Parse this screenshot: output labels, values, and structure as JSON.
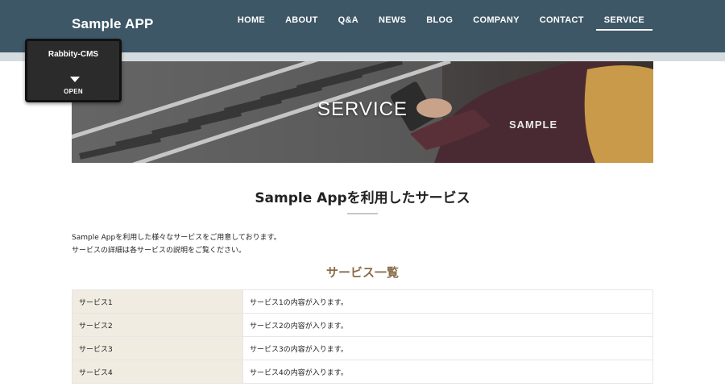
{
  "header": {
    "brand": "Sample APP",
    "nav": [
      "HOME",
      "ABOUT",
      "Q&A",
      "NEWS",
      "BLOG",
      "COMPANY",
      "CONTACT",
      "SERVICE"
    ],
    "active": "SERVICE"
  },
  "cms": {
    "logo": "Rabbity-CMS",
    "open_label": "OPEN"
  },
  "hero": {
    "title": "SERVICE",
    "watermark": "SAMPLE"
  },
  "main": {
    "heading": "Sample Appを利用したサービス",
    "intro_line1": "Sample Appを利用した様々なサービスをご用意しております。",
    "intro_line2": "サービスの詳細は各サービスの説明をご覧ください。",
    "list_title": "サービス一覧",
    "table": [
      {
        "name": "サービス1",
        "desc": "サービス1の内容が入ります。",
        "name_link": false,
        "desc_link": true
      },
      {
        "name": "サービス2",
        "desc": "サービス2の内容が入ります。",
        "name_link": true,
        "desc_link": false
      },
      {
        "name": "サービス3",
        "desc": "サービス3の内容が入ります。",
        "name_link": false,
        "desc_link": false
      },
      {
        "name": "サービス4",
        "desc": "サービス4の内容が入ります。",
        "name_link": false,
        "desc_link": false
      }
    ]
  },
  "colors": {
    "header_bg": "#3e5767",
    "link": "#2a6bb0",
    "list_title": "#8a6d4a",
    "table_label_bg": "#f1ece2"
  }
}
